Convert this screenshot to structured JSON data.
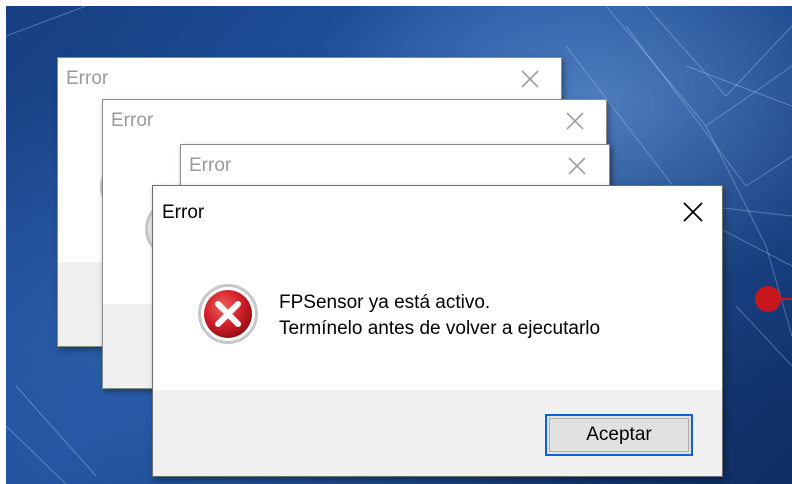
{
  "dialogs_background": [
    {
      "title": "Error",
      "close_icon": "close-icon"
    },
    {
      "title": "Error",
      "close_icon": "close-icon"
    },
    {
      "title": "Error",
      "close_icon": "close-icon"
    }
  ],
  "main_dialog": {
    "title": "Error",
    "message_line1": "FPSensor ya está activo.",
    "message_line2": "Termínelo antes de volver a ejecutarlo",
    "button_label": "Aceptar",
    "icon": "error-icon"
  },
  "colors": {
    "error_red": "#c8161d",
    "focus_blue": "#0f62d2",
    "footer_gray": "#f0f0f0",
    "wallpaper_blue": "#1d4f9a"
  }
}
